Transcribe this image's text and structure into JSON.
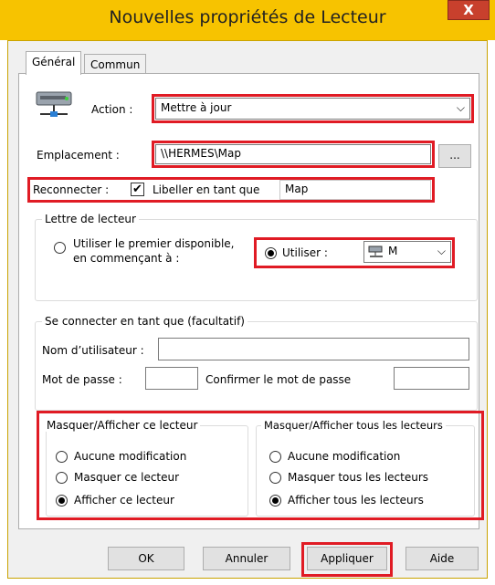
{
  "window": {
    "title": "Nouvelles propriétés de Lecteur",
    "close_label": "X"
  },
  "tabs": [
    {
      "label": "Général"
    },
    {
      "label": "Commun"
    }
  ],
  "action": {
    "label": "Action :",
    "value": "Mettre à jour"
  },
  "location": {
    "label": "Emplacement :",
    "value": "\\\\HERMES\\Map",
    "browse_label": "..."
  },
  "reconnect": {
    "label": "Reconnecter :",
    "checked": true,
    "check_mark": "✔",
    "label_as": "Libeller en tant que",
    "label_value": "Map"
  },
  "drive_letter": {
    "legend": "Lettre de lecteur",
    "first_available_line1": "Utiliser le premier disponible,",
    "first_available_line2": "en commençant à :",
    "use_label": "Utiliser :",
    "letter": "M"
  },
  "connect_as": {
    "legend": "Se connecter en tant que (facultatif)",
    "username_label": "Nom d’utilisateur :",
    "password_label": "Mot de passe :",
    "confirm_label": "Confirmer le mot de passe"
  },
  "hide_show_drive": {
    "legend": "Masquer/Afficher ce lecteur",
    "options": [
      "Aucune modification",
      "Masquer ce lecteur",
      "Afficher ce lecteur"
    ],
    "selected": 2
  },
  "hide_show_all": {
    "legend": "Masquer/Afficher tous les lecteurs",
    "options": [
      "Aucune modification",
      "Masquer tous les lecteurs",
      "Afficher tous les lecteurs"
    ],
    "selected": 2
  },
  "buttons": {
    "ok": "OK",
    "cancel": "Annuler",
    "apply": "Appliquer",
    "help": "Aide"
  },
  "colors": {
    "title_bar": "#f7c300",
    "highlight": "#e01b24"
  }
}
